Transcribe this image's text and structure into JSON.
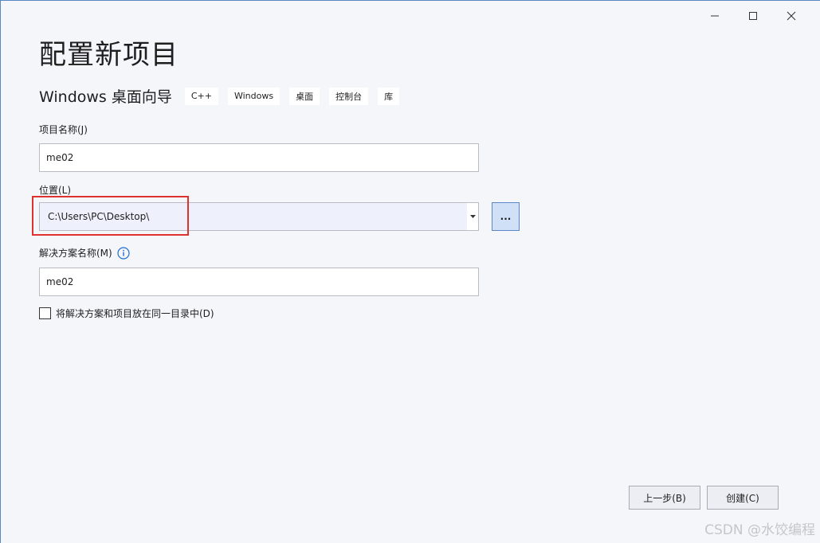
{
  "window": {
    "controls": {
      "minimize": "minimize-icon",
      "maximize": "maximize-icon",
      "close": "close-icon"
    }
  },
  "header": {
    "title": "配置新项目",
    "template_name": "Windows 桌面向导",
    "tags": [
      "C++",
      "Windows",
      "桌面",
      "控制台",
      "库"
    ]
  },
  "form": {
    "project_name_label": "项目名称(J)",
    "project_name_value": "me02",
    "location_label": "位置(L)",
    "location_value": "C:\\Users\\PC\\Desktop\\",
    "browse_label": "...",
    "solution_name_label": "解决方案名称(M)",
    "solution_name_value": "me02",
    "same_dir_label": "将解决方案和项目放在同一目录中(D)",
    "same_dir_checked": false
  },
  "footer": {
    "back_label": "上一步(B)",
    "create_label": "创建(C)"
  },
  "watermark": "CSDN @水饺编程",
  "colors": {
    "accent": "#5b86c5",
    "highlight": "#e03131",
    "background": "#f5f6fa"
  }
}
